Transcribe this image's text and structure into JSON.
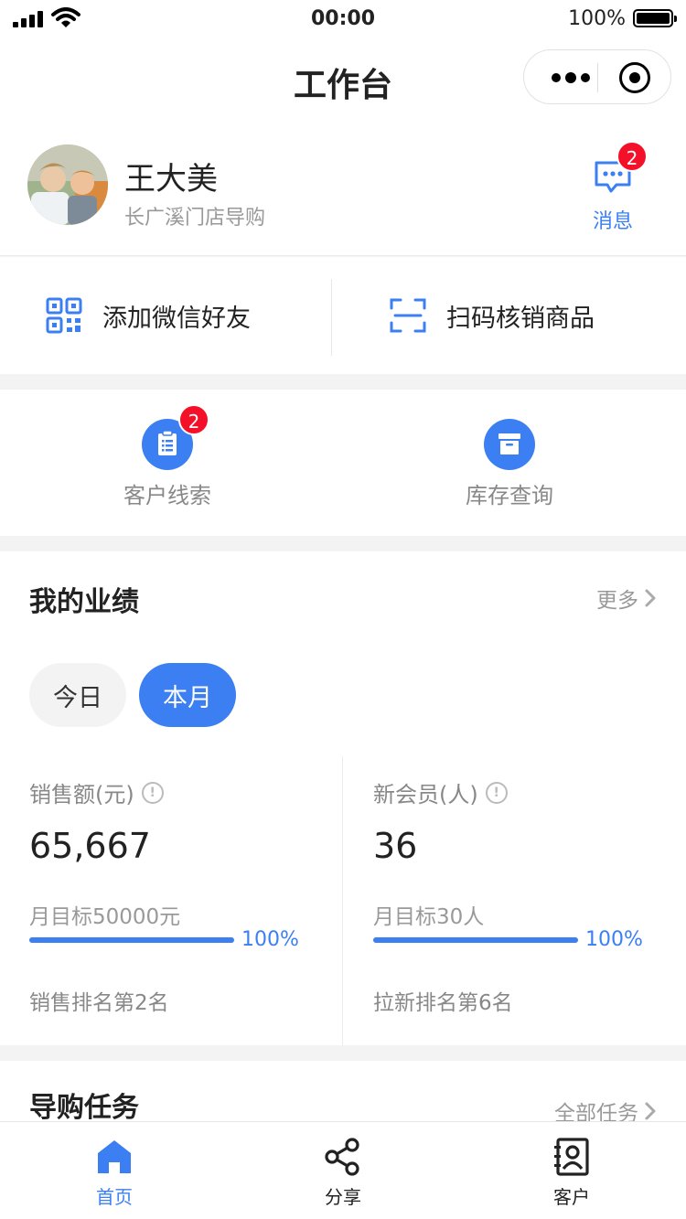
{
  "status_bar": {
    "time": "00:00",
    "battery": "100%"
  },
  "nav": {
    "title": "工作台"
  },
  "profile": {
    "name": "王大美",
    "store": "长广溪门店导购",
    "messages_label": "消息",
    "messages_badge": "2"
  },
  "quick_actions": [
    {
      "label": "添加微信好友",
      "icon": "qrcode-icon"
    },
    {
      "label": "扫码核销商品",
      "icon": "scan-icon"
    }
  ],
  "tools": [
    {
      "label": "客户线索",
      "icon": "clipboard-icon",
      "badge": "2"
    },
    {
      "label": "库存查询",
      "icon": "archive-box-icon"
    }
  ],
  "performance": {
    "title": "我的业绩",
    "more": "更多",
    "tabs": {
      "today": "今日",
      "month": "本月"
    },
    "selected_tab": "本月",
    "metrics": [
      {
        "label": "销售额(元)",
        "value": "65,667",
        "target": "月目标50000元",
        "progress": 1.0,
        "percent": "100%",
        "rank": "销售排名第2名"
      },
      {
        "label": "新会员(人)",
        "value": "36",
        "target": "月目标30人",
        "progress": 1.0,
        "percent": "100%",
        "rank": "拉新排名第6名"
      }
    ]
  },
  "tasks": {
    "title": "导购任务",
    "more": "全部任务"
  },
  "tabbar": [
    {
      "label": "首页",
      "icon": "home-icon",
      "active": true
    },
    {
      "label": "分享",
      "icon": "share-icon",
      "active": false
    },
    {
      "label": "客户",
      "icon": "contacts-icon",
      "active": false
    }
  ],
  "colors": {
    "accent": "#3b7ff2",
    "badge": "#f5102a"
  }
}
